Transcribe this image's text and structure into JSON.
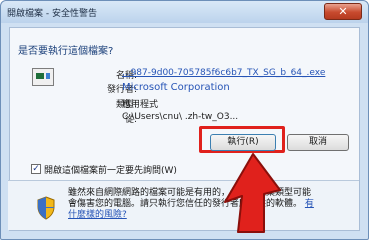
{
  "window": {
    "title": "開啟檔案 - 安全性警告",
    "close_label": "✕"
  },
  "dialog": {
    "question": "是否要執行這個檔案?",
    "fields": [
      {
        "label": "名稱:",
        "value": "...987-9d00-705785f6c6b7_TX_SG_b_64_.exe"
      },
      {
        "label": "發行者:",
        "value": "Microsoft Corporation"
      },
      {
        "label": "類型:",
        "value": "應用程式"
      },
      {
        "label": "從:",
        "value": "C:\\Users\\cnu\\                          .zh-tw_O3..."
      }
    ],
    "run_button": "執行(R)",
    "cancel_button": "取消",
    "checkbox_checked": true,
    "checkbox_label": "開啟這個檔案前一定要先詢問(W)",
    "warning_text": "雖然來自網際網路的檔案可能是有用的，但這個檔案類型可能會傷害您的電腦。請只執行您信任的發行者所提供的軟體。",
    "warning_link": "有什麼樣的風險?"
  },
  "colors": {
    "highlight": "#e0211c",
    "link": "#2654b6"
  },
  "icons": [
    "close-icon",
    "file-icon",
    "shield-icon",
    "red-arrow-icon"
  ]
}
